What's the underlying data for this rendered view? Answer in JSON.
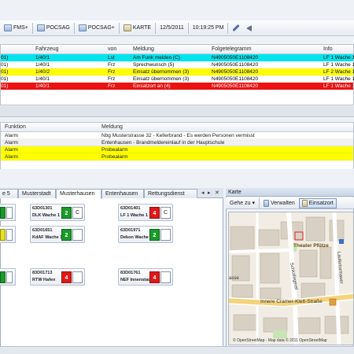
{
  "toolbar": {
    "items": [
      "FMS+",
      "POCSAG",
      "POCSAG+",
      "KARTE"
    ],
    "date": "12/5/2011",
    "time": "10:19:25 PM"
  },
  "grid1": {
    "headers": [
      "Fahrzeug",
      "von",
      "Meldung",
      "Folgetelegramm",
      "Info"
    ],
    "rows": [
      {
        "prefix": "01)",
        "fahrzeug": "1/40/1",
        "von": "Lst",
        "meldung": "Am Funk melden (C)",
        "folge": "N4905050E1108420",
        "info": "LF 1 Wache 1",
        "bg": "#00e5ef",
        "fg": "#000000"
      },
      {
        "prefix": "01)",
        "fahrzeug": "1/40/1",
        "von": "Frz",
        "meldung": "Sprechwunsch (5)",
        "folge": "N4905050E1108420",
        "info": "LF 1 Wache 1",
        "bg": "#ffffff",
        "fg": "#000000"
      },
      {
        "prefix": "01)",
        "fahrzeug": "1/40/2",
        "von": "Frz",
        "meldung": "Einsatz übernommen (3)",
        "folge": "N4905050E1108420",
        "info": "LF 2 Wache 1",
        "bg": "#ffff00",
        "fg": "#000000"
      },
      {
        "prefix": "01)",
        "fahrzeug": "1/40/1",
        "von": "Frz",
        "meldung": "Einsatz übernommen (3)",
        "folge": "N4905050E1108420",
        "info": "LF 1 Wache 1",
        "bg": "#ffffff",
        "fg": "#000000"
      },
      {
        "prefix": "01)",
        "fahrzeug": "1/40/1",
        "von": "Frz",
        "meldung": "Einsatzort an (4)",
        "folge": "N4905050E1108420",
        "info": "LF 1 Wache 1",
        "bg": "#ee1111",
        "fg": "#ffffff"
      }
    ]
  },
  "grid2": {
    "headers": [
      "Funktion",
      "Meldung"
    ],
    "rows": [
      {
        "funktion": "Alarm",
        "meldung": "Nbg Musterstrasse 32 - Kellerbrand - Es werden Personen vermisst",
        "bg": "#ffffff"
      },
      {
        "funktion": "Alarm",
        "meldung": "Entenhausen - Brandmeldereinlauf in der Hauptschule",
        "bg": "#f0f0f0"
      },
      {
        "funktion": "Alarm",
        "meldung": "Probealarm",
        "bg": "#ffff00"
      },
      {
        "funktion": "Alarm",
        "meldung": "Probealarm",
        "bg": "#ffff00"
      }
    ]
  },
  "tabs": {
    "items": [
      "e 5",
      "Musterstadt",
      "Musterhausen",
      "Entenhausen",
      "Rettungsdienst"
    ],
    "active": 2
  },
  "units": [
    {
      "id": "63D01301",
      "name": "DLK Wache 1",
      "status": "2",
      "status_color": "#1a9a2a",
      "box": "C"
    },
    {
      "id": "63D01401",
      "name": "LF 1 Wache 1",
      "status": "4",
      "status_color": "#e01818",
      "box": "C"
    },
    {
      "id": "63D01651",
      "name": "KdAF Wache 1",
      "status": "2",
      "status_color": "#1a9a2a",
      "box": ""
    },
    {
      "id": "63D01971",
      "name": "Dekon Wache 1",
      "status": "2",
      "status_color": "#1a9a2a",
      "box": ""
    },
    {
      "id": "83D01713",
      "name": "RTW Hafen",
      "status": "4",
      "status_color": "#e01818",
      "box": ""
    },
    {
      "id": "83D01761",
      "name": "NEF Innenstadt",
      "status": "4",
      "status_color": "#e01818",
      "box": ""
    }
  ],
  "cut_cards": [
    {
      "status_color": "#1a9a2a"
    },
    {
      "status_color": "#e8e020"
    },
    {
      "status_color": "#1a9a2a"
    }
  ],
  "map": {
    "title": "Karte",
    "toolbar": [
      "Gehe zu",
      "Verwalten",
      "Einsatzort"
    ],
    "labels": {
      "theater": "Theater Pfütze",
      "street1": "Schlotfegerel",
      "street2": "Laufertormauer",
      "street3": "Innere Cramer-Klett-Straße",
      "street4": "asse"
    },
    "credit": "© OpenStreetMap - Map data © 2011 OpenStreetMap"
  }
}
